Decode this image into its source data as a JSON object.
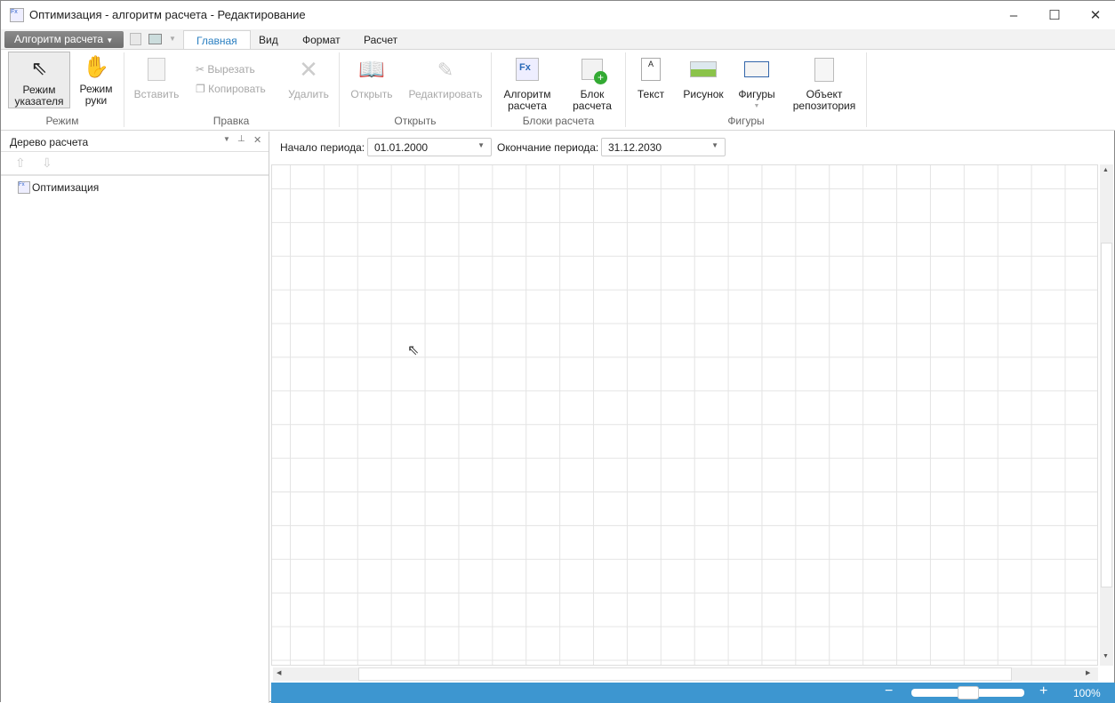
{
  "window": {
    "title": "Оптимизация - алгоритм расчета - Редактирование",
    "minimize": "–",
    "maximize": "☐",
    "close": "✕"
  },
  "app_menu": "Алгоритм расчета",
  "tabs": [
    "Главная",
    "Вид",
    "Формат",
    "Расчет"
  ],
  "ribbon": {
    "mode": {
      "group": "Режим",
      "pointer": [
        "Режим",
        "указателя"
      ],
      "hand": [
        "Режим",
        "руки"
      ]
    },
    "edit": {
      "group": "Правка",
      "paste": "Вставить",
      "cut": "Вырезать",
      "copy": "Копировать",
      "delete": "Удалить"
    },
    "open": {
      "group": "Открыть",
      "open": "Открыть",
      "edit": "Редактировать"
    },
    "blocks": {
      "group": "Блоки расчета",
      "algorithm": [
        "Алгоритм",
        "расчета"
      ],
      "block": [
        "Блок",
        "расчета"
      ]
    },
    "shapes": {
      "group": "Фигуры",
      "text": "Текст",
      "picture": "Рисунок",
      "shapes": "Фигуры",
      "repo": [
        "Объект",
        "репозитория"
      ]
    }
  },
  "tree": {
    "title": "Дерево расчета",
    "items": [
      "Оптимизация"
    ]
  },
  "period": {
    "start_label": "Начало периода:",
    "start": "01.01.2000",
    "end_label": "Окончание периода:",
    "end": "31.12.2030"
  },
  "status": {
    "zoom": "100%",
    "zoom_fraction": 0.5
  }
}
